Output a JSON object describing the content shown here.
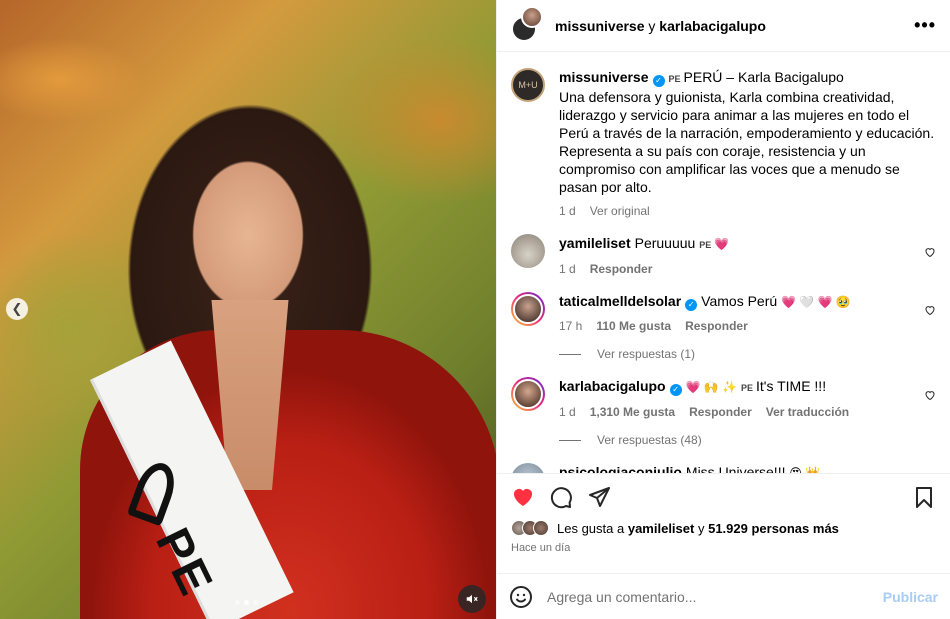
{
  "media": {
    "sash_text": "PE",
    "slide_count": 3,
    "active_slide": 2
  },
  "header": {
    "user1": "missuniverse",
    "and": "y",
    "user2": "karlabacigalupo"
  },
  "caption": {
    "username": "missuniverse",
    "flag": "PE",
    "title": "PERÚ – Karla Bacigalupo",
    "text": "Una defensora y guionista, Karla combina creatividad, liderazgo y servicio para animar a las mujeres en todo el Perú a través de la narración, empoderamiento y educación. Representa a su país con coraje, resistencia y un compromiso con amplificar las voces que a menudo se pasan por alto.",
    "time": "1 d",
    "see_original": "Ver original",
    "avatar_text": "M+U"
  },
  "comments": [
    {
      "username": "yamileliset",
      "text": "Peruuuuu",
      "flag": "PE",
      "emoji": "💗",
      "time": "1 d",
      "reply": "Responder"
    },
    {
      "username": "taticalmelldelsolar",
      "text": "Vamos Perú",
      "emoji": "💗 🤍 💗 🥹",
      "time": "17 h",
      "likes": "110 Me gusta",
      "reply": "Responder",
      "view_replies": "Ver respuestas (1)"
    },
    {
      "username": "karlabacigalupo",
      "emoji": "💗 🙌 ✨",
      "flag": "PE",
      "text": "It's TIME !!!",
      "time": "1 d",
      "likes": "1,310 Me gusta",
      "reply": "Responder",
      "translate": "Ver traducción",
      "view_replies": "Ver respuestas (48)"
    },
    {
      "username": "psicologiaconjulio",
      "text": "Miss Universe!!!",
      "emoji": "😍 👑"
    }
  ],
  "likes": {
    "prefix": "Les gusta a",
    "user": "yamileliset",
    "mid": "y",
    "count": "51.929 personas más"
  },
  "posted": "Hace un día",
  "composer": {
    "placeholder": "Agrega un comentario...",
    "publish": "Publicar"
  }
}
